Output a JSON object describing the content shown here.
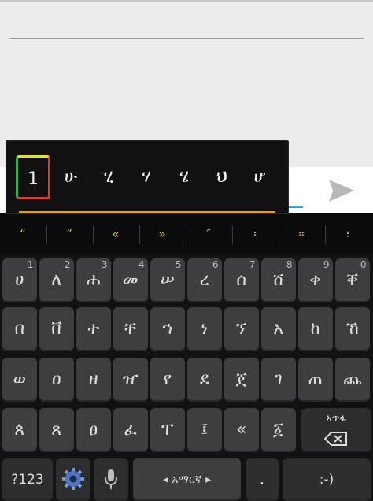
{
  "candidates": {
    "selected": "1",
    "items": [
      "ሁ",
      "ሂ",
      "ሃ",
      "ሄ",
      "ህ",
      "ሆ"
    ]
  },
  "punctuation_row": [
    "“",
    "”",
    "«",
    "»",
    "″",
    "፡",
    "።",
    "፣"
  ],
  "keyboard": {
    "row1": [
      {
        "label": "ሀ",
        "hint": "1"
      },
      {
        "label": "ለ",
        "hint": "2"
      },
      {
        "label": "ሐ",
        "hint": "3"
      },
      {
        "label": "መ",
        "hint": "4"
      },
      {
        "label": "ሠ",
        "hint": "5"
      },
      {
        "label": "ረ",
        "hint": "6"
      },
      {
        "label": "ሰ",
        "hint": "7"
      },
      {
        "label": "ሸ",
        "hint": "8"
      },
      {
        "label": "ቀ",
        "hint": "9"
      },
      {
        "label": "ቐ",
        "hint": "0"
      }
    ],
    "row2": [
      "በ",
      "ቨ",
      "ተ",
      "ቸ",
      "ኀ",
      "ነ",
      "ኘ",
      "አ",
      "ከ",
      "ኸ"
    ],
    "row3": [
      "ወ",
      "ዐ",
      "ዘ",
      "ዠ",
      "የ",
      "ደ",
      "ጀ",
      "ገ",
      "ጠ",
      "ጨ"
    ],
    "row4": [
      "ጰ",
      "ጸ",
      "ፀ",
      "ፈ",
      "ፐ",
      "፤",
      "«",
      "፩"
    ],
    "amharic_backspace_label": "አጥፋ",
    "numbers_key": "?123",
    "space_label": "◂ አማርኛ ▸",
    "period_key": ".",
    "smiley_key": ":-)"
  },
  "colors": {
    "punct_text": "#e0b43c",
    "popup_accent": "#e69a2a",
    "send_icon": "#b9b9b9"
  },
  "icons": [
    "send-icon",
    "settings-gear-icon",
    "microphone-icon",
    "backspace-icon"
  ]
}
